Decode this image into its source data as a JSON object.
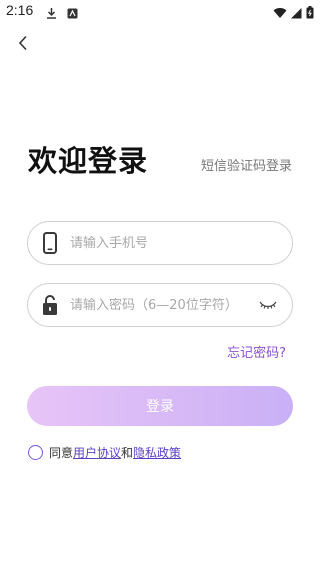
{
  "status_bar": {
    "time": "2:16",
    "icons": [
      "download-icon",
      "notification-icon",
      "wifi-icon",
      "signal-icon",
      "battery-icon"
    ]
  },
  "nav": {
    "back_icon": "chevron-left-icon"
  },
  "header": {
    "title": "欢迎登录",
    "sms_login_label": "短信验证码登录"
  },
  "form": {
    "phone": {
      "value": "",
      "placeholder": "请输入手机号",
      "icon": "phone-icon"
    },
    "password": {
      "value": "",
      "placeholder": "请输入密码（6—20位字符）",
      "icon": "lock-icon",
      "toggle_icon": "eye-closed-icon"
    },
    "forgot_label": "忘记密码?",
    "login_label": "登录"
  },
  "agreement": {
    "prefix": "同意",
    "user_agreement": "用户协议",
    "and": "和",
    "privacy_policy": "隐私政策",
    "checked": false
  },
  "colors": {
    "accent": "#8a4fd6",
    "button_gradient_start": "#e8c4f7",
    "button_gradient_end": "#c9b0f6",
    "link": "#5a3fc9"
  }
}
